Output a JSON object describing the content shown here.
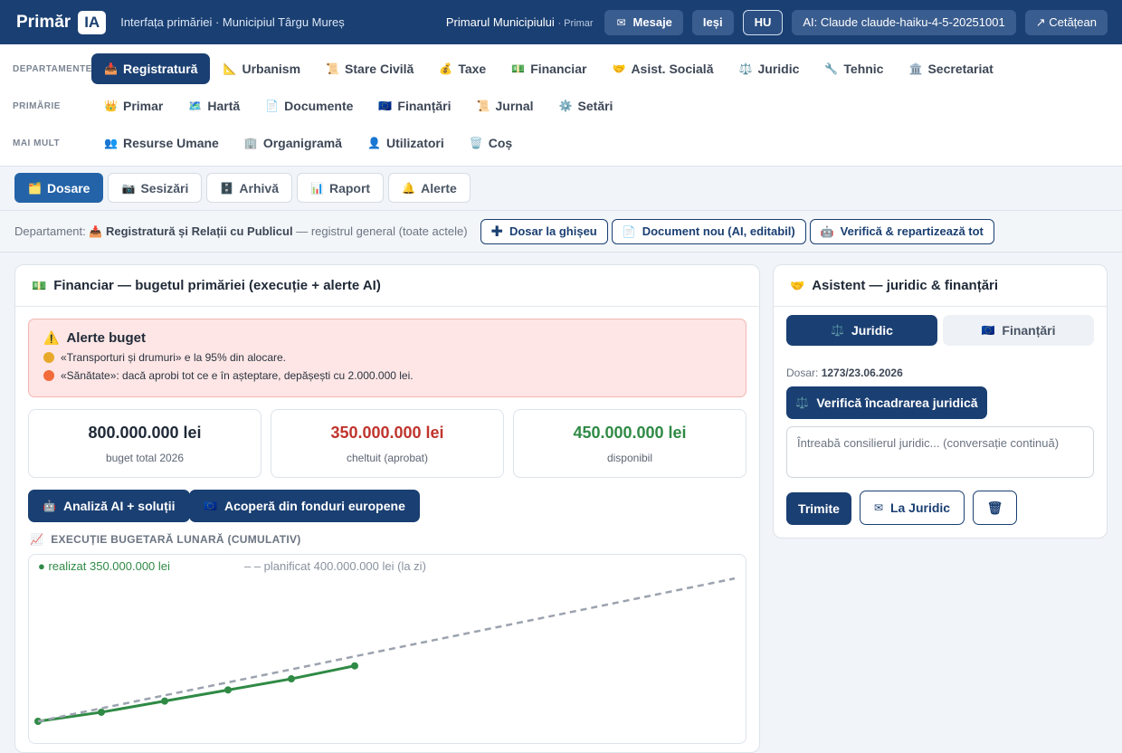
{
  "topbar": {
    "brand": "Primăr",
    "brand_badge": "IA",
    "subtitle": "Interfața primăriei · Municipiul Târgu Mureș",
    "role": "Primarul Municipiului",
    "role_small": "· Primar",
    "messages": "Mesaje",
    "messages_icon": "envelope-icon",
    "logout": "Ieși",
    "lang": "HU",
    "ai_model": "AI: Claude claude-haiku-4-5-20251001",
    "citizen": "↗ Cetățean"
  },
  "nav": {
    "label_departments": "DEPARTAMENTE",
    "label_primarie": "PRIMĂRIE",
    "label_more": "MAI MULT",
    "departments": [
      {
        "label": "Registratură",
        "icon": "📥",
        "active": true
      },
      {
        "label": "Urbanism",
        "icon": "📐"
      },
      {
        "label": "Stare Civilă",
        "icon": "📜"
      },
      {
        "label": "Taxe",
        "icon": "💰"
      },
      {
        "label": "Financiar",
        "icon": "💵"
      },
      {
        "label": "Asist. Socială",
        "icon": "🤝"
      },
      {
        "label": "Juridic",
        "icon": "⚖️"
      },
      {
        "label": "Tehnic",
        "icon": "🔧"
      },
      {
        "label": "Secretariat",
        "icon": "🏛️"
      }
    ],
    "primarie": [
      {
        "label": "Primar",
        "icon": "👑"
      },
      {
        "label": "Hartă",
        "icon": "🗺️"
      },
      {
        "label": "Documente",
        "icon": "📄"
      },
      {
        "label": "Finanțări",
        "icon": "🇪🇺"
      },
      {
        "label": "Jurnal",
        "icon": "📜"
      },
      {
        "label": "Setări",
        "icon": "⚙️"
      }
    ],
    "more": [
      {
        "label": "Resurse Umane",
        "icon": "👥"
      },
      {
        "label": "Organigramă",
        "icon": "🏢"
      },
      {
        "label": "Utilizatori",
        "icon": "👤"
      },
      {
        "label": "Coș",
        "icon": "🗑️"
      }
    ]
  },
  "subtabs": [
    {
      "label": "Dosare",
      "icon": "🗂️",
      "active": true
    },
    {
      "label": "Sesizări",
      "icon": "📷"
    },
    {
      "label": "Arhivă",
      "icon": "🗄️"
    },
    {
      "label": "Raport",
      "icon": "📊"
    },
    {
      "label": "Alerte",
      "icon": "🔔"
    }
  ],
  "dept": {
    "prefix": "Departament:",
    "icon": "📥",
    "name": "Registratură și Relații cu Publicul",
    "suffix": " — registrul general (toate actele)",
    "btn_ghiseu": "Dosar la ghișeu",
    "btn_doc": "Document nou (AI, editabil)",
    "btn_verify": "Verifică & repartizează tot"
  },
  "financiar": {
    "title": "Financiar — bugetul primăriei (execuție + alerte AI)",
    "alert_title": "Alerte buget",
    "alert_1": "«Transporturi și drumuri» e la 95% din alocare.",
    "alert_2": "«Sănătate»: dacă aprobi tot ce e în așteptare, depășești cu 2.000.000 lei.",
    "alert_1_color": "#e8a92b",
    "alert_2_color": "#f26b3a",
    "stats": [
      {
        "value": "800.000.000 lei",
        "label": "buget total 2026",
        "color": "#1f2937"
      },
      {
        "value": "350.000.000 lei",
        "label": "cheltuit (aprobat)",
        "color": "#c0342d"
      },
      {
        "value": "450.000.000 lei",
        "label": "disponibil",
        "color": "#2f8a45"
      }
    ],
    "btn_ai": "Analiză AI + soluții",
    "btn_eu": "Acoperă din fonduri europene",
    "chart_title": "EXECUȚIE BUGETARĂ LUNARĂ (CUMULATIV)",
    "legend_actual": "● realizat 350.000.000 lei",
    "legend_planned": "– – planificat 400.000.000 lei (la zi)"
  },
  "chart_data": {
    "type": "line",
    "title": "EXECUȚIE BUGETARĂ LUNARĂ (CUMULATIV)",
    "series": [
      {
        "name": "realizat",
        "x": [
          1,
          2,
          3,
          4,
          5,
          6
        ],
        "values": [
          0,
          49,
          109,
          169,
          229,
          299
        ],
        "color": "#2f8a45"
      },
      {
        "name": "planificat",
        "x": [
          1,
          12
        ],
        "values": [
          0,
          770
        ],
        "color": "#9ca3af",
        "dashed": true
      }
    ]
  },
  "assistant": {
    "title": "Asistent — juridic & finanțări",
    "tab_juridic": "Juridic",
    "tab_finantari": "Finanțări",
    "dosar_label": "Dosar:",
    "dosar_value": "1273/23.06.2026",
    "btn_verify": "Verifică încadrarea juridică",
    "input_placeholder": "Întreabă consilierul juridic... (conversație continuă)",
    "btn_send": "Trimite",
    "btn_to_legal": "La Juridic"
  }
}
